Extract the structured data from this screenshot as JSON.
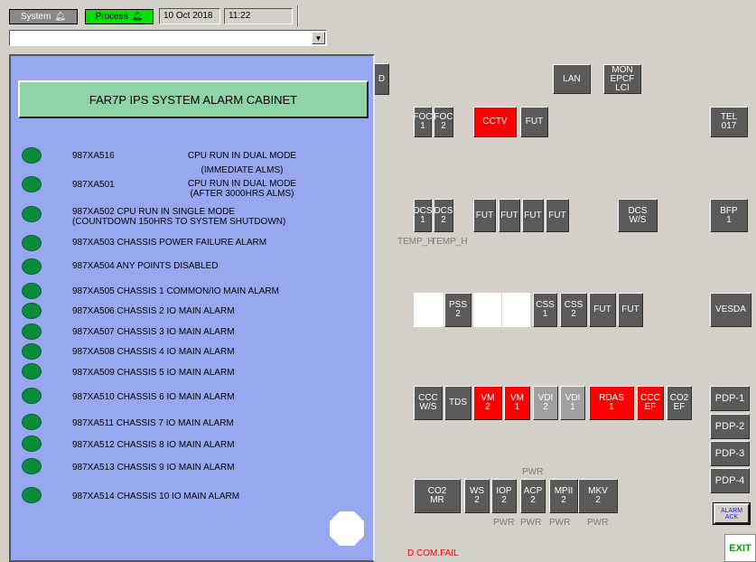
{
  "toolbar": {
    "system_label": "System",
    "process_label": "Process",
    "date": "10 Oct 2018",
    "time": "11:22",
    "combo_value": ""
  },
  "panel": {
    "title": "FAR7P IPS SYSTEM ALARM CABINET",
    "alarms": [
      {
        "code": "987XA516",
        "desc": "CPU RUN IN DUAL MODE",
        "desc2": "(IMMEDIATE ALMS)"
      },
      {
        "code": "987XA501",
        "desc": "CPU RUN IN DUAL MODE",
        "desc2": "(AFTER 3000HRS ALMS)"
      },
      {
        "text": "987XA502 CPU RUN IN SINGLE MODE",
        "text2": "(COUNTDOWN 150HRS TO SYSTEM SHUTDOWN)"
      },
      {
        "text": "987XA503 CHASSIS POWER FAILURE ALARM"
      },
      {
        "text": "987XA504 ANY POINTS DISABLED"
      },
      {
        "text": "987XA505 CHASSIS 1 COMMON/IO MAIN ALARM"
      },
      {
        "text": "987XA506 CHASSIS 2 IO MAIN ALARM"
      },
      {
        "text": "987XA507 CHASSIS 3 IO MAIN ALARM"
      },
      {
        "text": "987XA508 CHASSIS 4 IO MAIN ALARM"
      },
      {
        "text": "987XA509 CHASSIS 5 IO MAIN ALARM"
      },
      {
        "text": "987XA510 CHASSIS 6 IO MAIN ALARM"
      },
      {
        "text": "987XA511 CHASSIS 7 IO MAIN ALARM"
      },
      {
        "text": "987XA512 CHASSIS 8 IO MAIN ALARM"
      },
      {
        "text": "987XA513 CHASSIS 9 IO MAIN ALARM"
      },
      {
        "text": "987XA514 CHASSIS 10 IO MAIN ALARM"
      }
    ]
  },
  "buttons": {
    "partial": "D",
    "lan": "LAN",
    "mon": [
      "MON",
      "EPCF",
      "LCI"
    ],
    "foc1": [
      "FOC",
      "1"
    ],
    "foc2": [
      "FOC",
      "2"
    ],
    "cctv": "CCTV",
    "fut": "FUT",
    "tel": [
      "TEL",
      "017"
    ],
    "dcs1": [
      "DCS",
      "1"
    ],
    "dcs2": [
      "DCS",
      "2"
    ],
    "dcsws": [
      "DCS",
      "W/S"
    ],
    "bfp": [
      "BFP",
      "1"
    ],
    "pss2": [
      "PSS",
      "2"
    ],
    "css1": [
      "CSS",
      "1"
    ],
    "css2": [
      "CSS",
      "2"
    ],
    "vesda": "VESDA",
    "cccws": [
      "CCC",
      "W/S"
    ],
    "tds": "TDS",
    "vm2": [
      "VM",
      "2"
    ],
    "vm1": [
      "VM",
      "1"
    ],
    "vdi2": [
      "VDI",
      "2"
    ],
    "vdi1": [
      "VDI",
      "1"
    ],
    "rdas": [
      "RDAS",
      "1"
    ],
    "cccef": [
      "CCC",
      "EF"
    ],
    "co2ef": [
      "CO2",
      "EF"
    ],
    "pdp1": "PDP-1",
    "pdp2": "PDP-2",
    "pdp3": "PDP-3",
    "pdp4": "PDP-4",
    "co2mr": [
      "CO2",
      "MR"
    ],
    "ws2": [
      "WS",
      "2"
    ],
    "iop2": [
      "IOP",
      "2"
    ],
    "acp2": [
      "ACP",
      "2"
    ],
    "mpii2": [
      "MPII",
      "2"
    ],
    "mkv2": [
      "MKV",
      "2"
    ],
    "alarm_ack": [
      "ALARM",
      "ACK"
    ],
    "exit": "EXIT"
  },
  "labels": {
    "temp_h": "TEMP_H",
    "pwr": "PWR",
    "com_fail": "D COM.FAIL"
  },
  "colors": {
    "panel_bg": "#98a8f0",
    "title_bg": "#8fd4a8",
    "led_green": "#0b8a3c",
    "alarm_red": "#ff0000",
    "button_gray": "#5a5a5a",
    "process_green": "#00e000"
  }
}
